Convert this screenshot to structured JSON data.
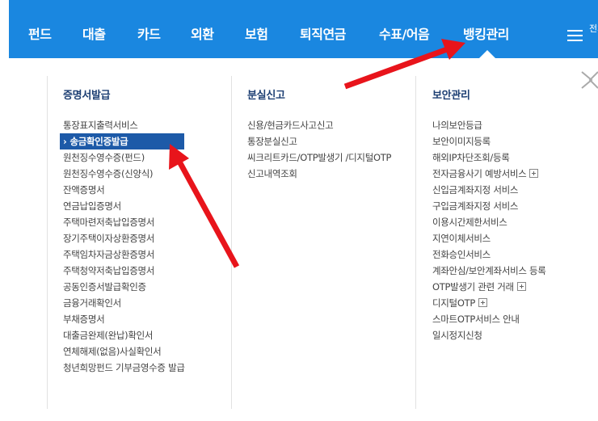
{
  "nav": {
    "items": [
      "펀드",
      "대출",
      "카드",
      "외환",
      "보험",
      "퇴직연금",
      "수표/어음",
      "뱅킹관리"
    ],
    "all_menu_label": "전체메뉴"
  },
  "colors": {
    "nav_bg": "#1a87e0",
    "heading": "#1d3f73",
    "active_bg": "#1d5aa8",
    "annotation_arrow": "#e8141b"
  },
  "columns": [
    {
      "title": "증명서발급",
      "items": [
        {
          "label": "통장표지출력서비스"
        },
        {
          "label": "송금확인증발급",
          "active": true
        },
        {
          "label": "원천징수영수증(펀드)"
        },
        {
          "label": "원천징수영수증(신양식)"
        },
        {
          "label": "잔액증명서"
        },
        {
          "label": "연금납입증명서"
        },
        {
          "label": "주택마련저축납입증명서"
        },
        {
          "label": "장기주택이자상환증명서"
        },
        {
          "label": "주택임차자금상환증명서"
        },
        {
          "label": "주택청약저축납입증명서"
        },
        {
          "label": "공동인증서발급확인증"
        },
        {
          "label": "금융거래확인서"
        },
        {
          "label": "부채증명서"
        },
        {
          "label": "대출금완제(완납)확인서"
        },
        {
          "label": "연체해제(없음)사실확인서"
        },
        {
          "label": "청년희망펀드 기부금영수증 발급",
          "wrap": true
        }
      ]
    },
    {
      "title": "분실신고",
      "items": [
        {
          "label": "신용/현금카드사고신고"
        },
        {
          "label": "통장분실신고"
        },
        {
          "label": "씨크리트카드/OTP발생기 /디지털OTP",
          "wrap": true
        },
        {
          "label": "신고내역조회"
        }
      ]
    },
    {
      "title": "보안관리",
      "items": [
        {
          "label": "나의보안등급"
        },
        {
          "label": "보안이미지등록"
        },
        {
          "label": "해외IP차단조회/등록"
        },
        {
          "label": "전자금융사기 예방서비스",
          "plus": true
        },
        {
          "label": "신입금계좌지정 서비스"
        },
        {
          "label": "구입금계좌지정 서비스"
        },
        {
          "label": "이용시간제한서비스"
        },
        {
          "label": "지연이체서비스"
        },
        {
          "label": "전화승인서비스"
        },
        {
          "label": "계좌안심/보안계좌서비스 등록"
        },
        {
          "label": "OTP발생기 관련 거래",
          "plus": true
        },
        {
          "label": "디지털OTP",
          "plus": true
        },
        {
          "label": "스마트OTP서비스 안내"
        },
        {
          "label": "일시정지신청"
        }
      ]
    }
  ]
}
